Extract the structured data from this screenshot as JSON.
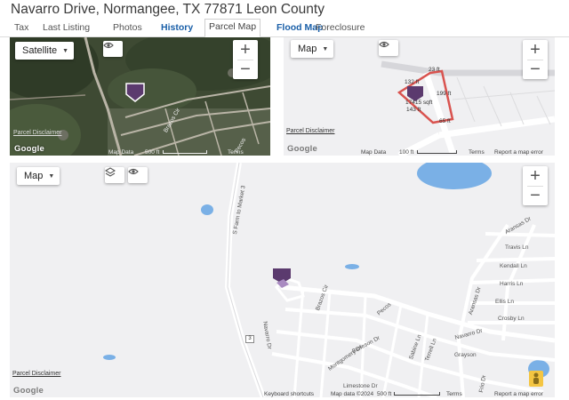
{
  "page_title": "Navarro Drive, Normangee, TX 77871 Leon County",
  "tabs": [
    {
      "label": "Tax",
      "state": "normal"
    },
    {
      "label": "Last Listing",
      "state": "normal"
    },
    {
      "label": "Photos",
      "state": "normal"
    },
    {
      "label": "History",
      "state": "blue"
    },
    {
      "label": "Parcel Map",
      "state": "active"
    },
    {
      "label": "Flood Map",
      "state": "blue"
    },
    {
      "label": "Foreclosure",
      "state": "normal"
    }
  ],
  "colors": {
    "tab_blue": "#1a5fa8",
    "parcel_marker": "#5b3a6e",
    "parcel_line": "#d9534f",
    "water": "#7ab0e6",
    "map_bg": "#f0f0f2"
  },
  "satellite_map": {
    "type_label": "Satellite",
    "zoom_in": "+",
    "zoom_out": "−",
    "street_label": "Brazos Cir",
    "street_label_2": "Pecos",
    "disclaimer": "Parcel Disclaimer",
    "logo": "Google",
    "footer": [
      "Map Data",
      "500 ft",
      "Terms"
    ]
  },
  "parcel_map": {
    "type_label": "Map",
    "zoom_in": "+",
    "zoom_out": "−",
    "dimensions": [
      "23 ft",
      "132 ft",
      "199 ft",
      "17415 sqft",
      "143 ft",
      "65 ft"
    ],
    "disclaimer": "Parcel Disclaimer",
    "logo": "Google",
    "footer": [
      "Map Data",
      "100 ft",
      "Terms",
      "Report a map error"
    ]
  },
  "large_map": {
    "type_label": "Map",
    "zoom_in": "+",
    "zoom_out": "−",
    "road_label": "S Farm to Market 3",
    "road_shield": "3",
    "streets": [
      "Aransas Dr",
      "Travis Ln",
      "Kendall Ln",
      "Harris Ln",
      "Ellis Ln",
      "Crosby Ln",
      "Aransas Dr",
      "Navarro Dr",
      "Terrell Ln",
      "Grayson",
      "Sabine Ln",
      "Pecos",
      "Brazos Cir",
      "Navarro Dr",
      "Burleson Dr",
      "Montgomery Dr",
      "Limestone Dr",
      "Frio Dr"
    ],
    "disclaimer": "Parcel Disclaimer",
    "logo": "Google",
    "footer": [
      "Keyboard shortcuts",
      "Map data ©2024",
      "500 ft",
      "Terms",
      "Report a map error"
    ]
  }
}
